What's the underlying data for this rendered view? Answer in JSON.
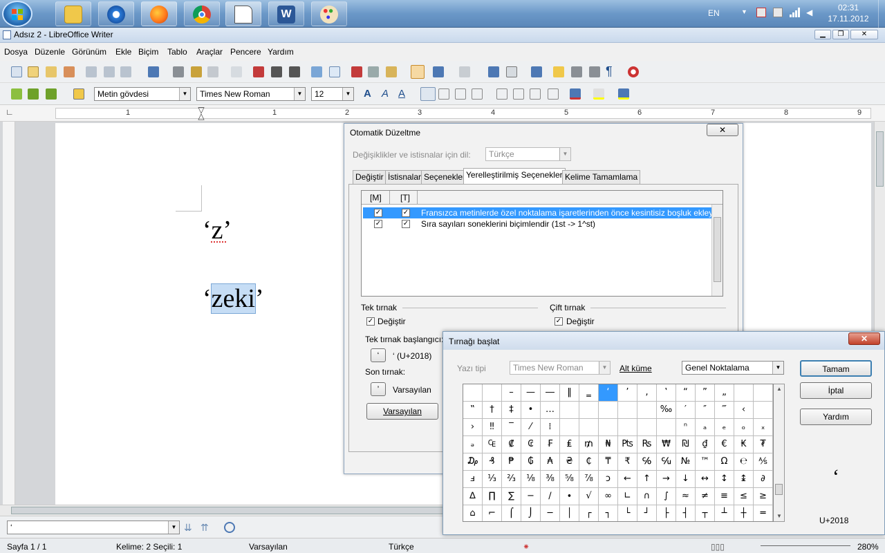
{
  "taskbar": {
    "lang": "EN",
    "time": "02:31",
    "date": "17.11.2012",
    "apps": [
      "explorer",
      "internet-explorer",
      "firefox",
      "chrome",
      "notepad",
      "word",
      "paint"
    ]
  },
  "window": {
    "title": "Adsız 2 - LibreOffice Writer"
  },
  "menu": [
    "Dosya",
    "Düzenle",
    "Görünüm",
    "Ekle",
    "Biçim",
    "Tablo",
    "Araçlar",
    "Pencere",
    "Yardım"
  ],
  "format": {
    "style": "Metin gövdesi",
    "font": "Times New Roman",
    "size": "12"
  },
  "ruler": [
    "1",
    "1",
    "2",
    "3",
    "4",
    "5",
    "6",
    "7",
    "8",
    "9"
  ],
  "document": {
    "line1": "‘z’",
    "line2_q1": "‘",
    "line2_sel": "zeki",
    "line2_q2": "’"
  },
  "find": {
    "value": "‘"
  },
  "status": {
    "page": "Sayfa 1 / 1",
    "words": "Kelime: 2 Seçili: 1",
    "style": "Varsayılan",
    "lang": "Türkçe",
    "zoom": "280%"
  },
  "autocorrect": {
    "title": "Otomatik Düzeltme",
    "lang_label": "Değişiklikler ve istisnalar için dil:",
    "lang_value": "Türkçe",
    "tabs": [
      "Değiştir",
      "İstisnalar",
      "Seçenekler",
      "Yerelleştirilmiş Seçenekler",
      "Kelime Tamamlama"
    ],
    "col_m": "[M]",
    "col_t": "[T]",
    "options": [
      "Fransızca metinlerde özel noktalama işaretlerinden önce kesintisiz boşluk ekleyin",
      "Sıra sayıları soneklerini biçimlendir (1st -> 1^st)"
    ],
    "single": {
      "header": "Tek tırnak",
      "replace": "Değiştir",
      "start_label": "Tek tırnak başlangıcı:",
      "start_char": "‘",
      "start_code": "‘ (U+2018)",
      "end_label": "Son tırnak:",
      "end_char": "’",
      "end_value": "Varsayılan",
      "default_btn": "Varsayılan"
    },
    "double": {
      "header": "Çift tırnak",
      "replace": "Değiştir"
    }
  },
  "specialchar": {
    "title": "Tırnağı başlat",
    "font_label": "Yazı tipi",
    "font_value": "Times New Roman",
    "subset_label": "Alt küme",
    "subset_value": "Genel Noktalama",
    "ok": "Tamam",
    "cancel": "İptal",
    "help": "Yardım",
    "preview": "‘",
    "code": "U+2018",
    "rows": [
      [
        " ",
        " ",
        "–",
        "—",
        "―",
        "‖",
        "‗",
        "‘",
        "’",
        "‚",
        "‛",
        "“",
        "”",
        "„"
      ],
      [
        "‟",
        "†",
        "‡",
        "•",
        "…",
        " ",
        " ",
        " ",
        " ",
        " ",
        "‰",
        "′",
        "″",
        "‴",
        "‹"
      ],
      [
        "›",
        "‼",
        "‾",
        "⁄",
        "⁞",
        " ",
        " ",
        " ",
        " ",
        " ",
        " ",
        "ⁿ",
        "ₐ",
        "ₑ",
        "ₒ",
        "ₓ"
      ],
      [
        "ₔ",
        "₠",
        "₡",
        "₢",
        "₣",
        "₤",
        "₥",
        "₦",
        "₧",
        "₨",
        "₩",
        "₪",
        "₫",
        "€",
        "₭",
        "₮"
      ],
      [
        "₯",
        "₰",
        "₱",
        "₲",
        "₳",
        "₴",
        "₵",
        "₸",
        "₹",
        "℅",
        "℆",
        "№",
        "™",
        "Ω",
        "℮",
        "⅍"
      ],
      [
        "ⅎ",
        "⅓",
        "⅔",
        "⅛",
        "⅜",
        "⅝",
        "⅞",
        "ↄ",
        "←",
        "↑",
        "→",
        "↓",
        "↔",
        "↕",
        "↨",
        "∂"
      ],
      [
        "∆",
        "∏",
        "∑",
        "−",
        "∕",
        "∙",
        "√",
        "∞",
        "∟",
        "∩",
        "∫",
        "≈",
        "≠",
        "≡",
        "≤",
        "≥"
      ],
      [
        "⌂",
        "⌐",
        "⌠",
        "⌡",
        "─",
        "│",
        "┌",
        "┐",
        "└",
        "┘",
        "├",
        "┤",
        "┬",
        "┴",
        "┼",
        "═"
      ]
    ]
  }
}
